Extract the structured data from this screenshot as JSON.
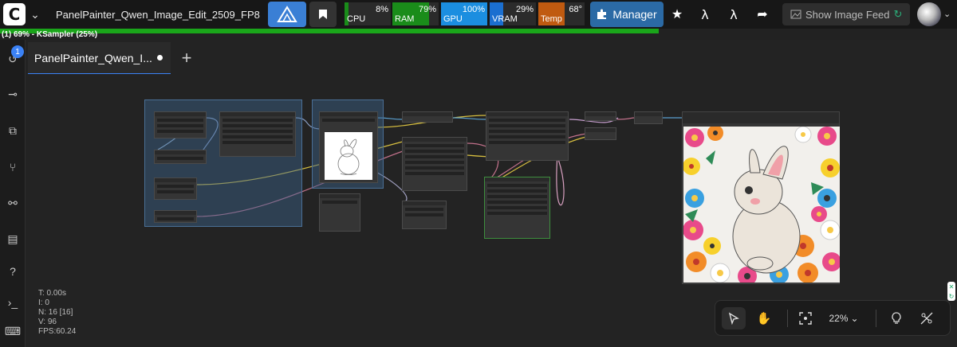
{
  "topbar": {
    "workflow_title": "PanelPainter_Qwen_Image_Edit_2509_FP8",
    "logo_icon": "comfy-logo-icon",
    "stats": [
      {
        "label": "CPU",
        "value": "8%",
        "percent": 8,
        "color": "#1a8c1a"
      },
      {
        "label": "RAM",
        "value": "79%",
        "percent": 79,
        "color": "#1a8c1a"
      },
      {
        "label": "GPU",
        "value": "100%",
        "percent": 100,
        "color": "#1b8ee0"
      },
      {
        "label": "VRAM",
        "value": "29%",
        "percent": 29,
        "color": "#1b6fd0"
      },
      {
        "label": "Temp",
        "value": "68°",
        "percent": 68,
        "color": "#c05a10"
      }
    ],
    "manager_label": "Manager",
    "feed_label": "Show Image Feed",
    "icons": [
      "star-icon",
      "lambda-icon",
      "lambda-icon",
      "share-icon"
    ]
  },
  "progress": {
    "text": "(1) 69% - KSampler (25%)",
    "percent": 69
  },
  "sidebar": {
    "badge": "1",
    "icons": [
      "history-icon",
      "nodes-icon",
      "models-icon",
      "workflows-icon",
      "hierarchy-icon",
      "templates-icon",
      "help-icon",
      "terminal-icon",
      "keyboard-icon"
    ]
  },
  "tabs": [
    {
      "label": "PanelPainter_Qwen_I...",
      "unsaved": true
    }
  ],
  "canvas_stats": {
    "t": "T: 0.00s",
    "i": "I: 0",
    "n": "N: 16 [16]",
    "v": "V: 96",
    "fps": "FPS:60.24"
  },
  "canvas_toolbar": {
    "zoom": "22%",
    "tools": [
      "select-icon",
      "hand-icon",
      "fit-view-icon",
      "lightbulb-icon",
      "link-visibility-icon"
    ]
  },
  "colors": {
    "accent": "#3b82f6",
    "progress_green": "#1aa51a",
    "manager_blue": "#2b6aa5"
  }
}
